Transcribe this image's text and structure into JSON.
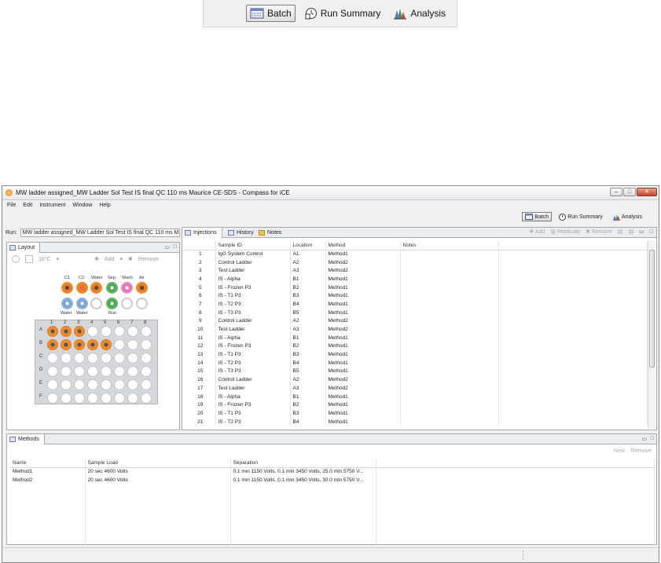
{
  "perspectives": [
    {
      "label": "Batch",
      "icon": "batch-icon",
      "active": true
    },
    {
      "label": "Run Summary",
      "icon": "run-summary-icon",
      "active": false
    },
    {
      "label": "Analysis",
      "icon": "analysis-icon",
      "active": false
    }
  ],
  "window": {
    "title": "MW ladder assigned_MW Ladder Sol Test IS final QC 110 ms Maurice CE-SDS - Compass for iCE"
  },
  "menu": [
    "File",
    "Edit",
    "Instrument",
    "Window",
    "Help"
  ],
  "run": {
    "label": "Run:",
    "value": "MW ladder assigned_MW Ladder Sol Test IS final QC 110 ms M"
  },
  "layout_panel": {
    "tab_label": "Layout",
    "temperature": "10°C",
    "add_label": "Add",
    "remove_label": "Remove",
    "cap_labels_top": [
      "C1",
      "C2",
      "Water",
      "Sep.",
      "Wash",
      "Air"
    ],
    "cap_labels_bottom": [
      "Water",
      "Water",
      "Run"
    ],
    "plate_cols": [
      "1",
      "2",
      "3",
      "4",
      "5",
      "6",
      "7",
      "8"
    ],
    "plate_rows": [
      "A",
      "B",
      "C",
      "D",
      "E",
      "F"
    ]
  },
  "injections_panel": {
    "tabs": [
      "Injections",
      "History",
      "Notes"
    ],
    "tools": [
      "Add",
      "Replicate",
      "Remove"
    ],
    "columns": [
      "",
      "Sample ID",
      "Location",
      "Method",
      "Notes"
    ],
    "rows": [
      [
        "1",
        "IgG System Control",
        "A1",
        "Method1",
        ""
      ],
      [
        "2",
        "Control Ladder",
        "A2",
        "Method2",
        ""
      ],
      [
        "3",
        "Test Ladder",
        "A3",
        "Method2",
        ""
      ],
      [
        "4",
        "IS - Alpha",
        "B1",
        "Method1",
        ""
      ],
      [
        "5",
        "IS - Frozen P3",
        "B2",
        "Method1",
        ""
      ],
      [
        "6",
        "IS - T1 P3",
        "B3",
        "Method1",
        ""
      ],
      [
        "7",
        "IS - T2 P3",
        "B4",
        "Method1",
        ""
      ],
      [
        "8",
        "IS - T3 P3",
        "B5",
        "Method1",
        ""
      ],
      [
        "9",
        "Control Ladder",
        "A2",
        "Method2",
        ""
      ],
      [
        "10",
        "Test Ladder",
        "A3",
        "Method2",
        ""
      ],
      [
        "11",
        "IS - Alpha",
        "B1",
        "Method1",
        ""
      ],
      [
        "12",
        "IS - Frozen P3",
        "B2",
        "Method1",
        ""
      ],
      [
        "13",
        "IS - T1 P3",
        "B3",
        "Method1",
        ""
      ],
      [
        "14",
        "IS - T2 P3",
        "B4",
        "Method1",
        ""
      ],
      [
        "15",
        "IS - T3 P3",
        "B5",
        "Method1",
        ""
      ],
      [
        "16",
        "Control Ladder",
        "A2",
        "Method2",
        ""
      ],
      [
        "17",
        "Test Ladder",
        "A3",
        "Method2",
        ""
      ],
      [
        "18",
        "IS - Alpha",
        "B1",
        "Method1",
        ""
      ],
      [
        "19",
        "IS - Frozen P3",
        "B2",
        "Method1",
        ""
      ],
      [
        "20",
        "IS - T1 P3",
        "B3",
        "Method1",
        ""
      ],
      [
        "21",
        "IS - T2 P3",
        "B4",
        "Method1",
        ""
      ]
    ]
  },
  "methods_panel": {
    "tab_label": "Methods",
    "tools": [
      "New",
      "Remove"
    ],
    "columns": [
      "Name",
      "Sample Load",
      "Separation",
      ""
    ],
    "rows": [
      [
        "Method1",
        "20 sec 4600 Volts",
        "0.1 min 1150 Volts, 0.1 min 3450 Volts, 25.0 min 5750 V...",
        ""
      ],
      [
        "Method2",
        "20 sec 4600 Volts",
        "0.1 min 1150 Volts, 0.1 min 3450 Volts, 30.0 min 5750 V...",
        ""
      ]
    ]
  },
  "colors": {
    "capillary_orange": "#f08b2b",
    "capillary_blue": "#7aa5d8",
    "capillary_green": "#4daa52",
    "capillary_pink": "#e275b8",
    "plate_bg": "#d4d7dc"
  }
}
